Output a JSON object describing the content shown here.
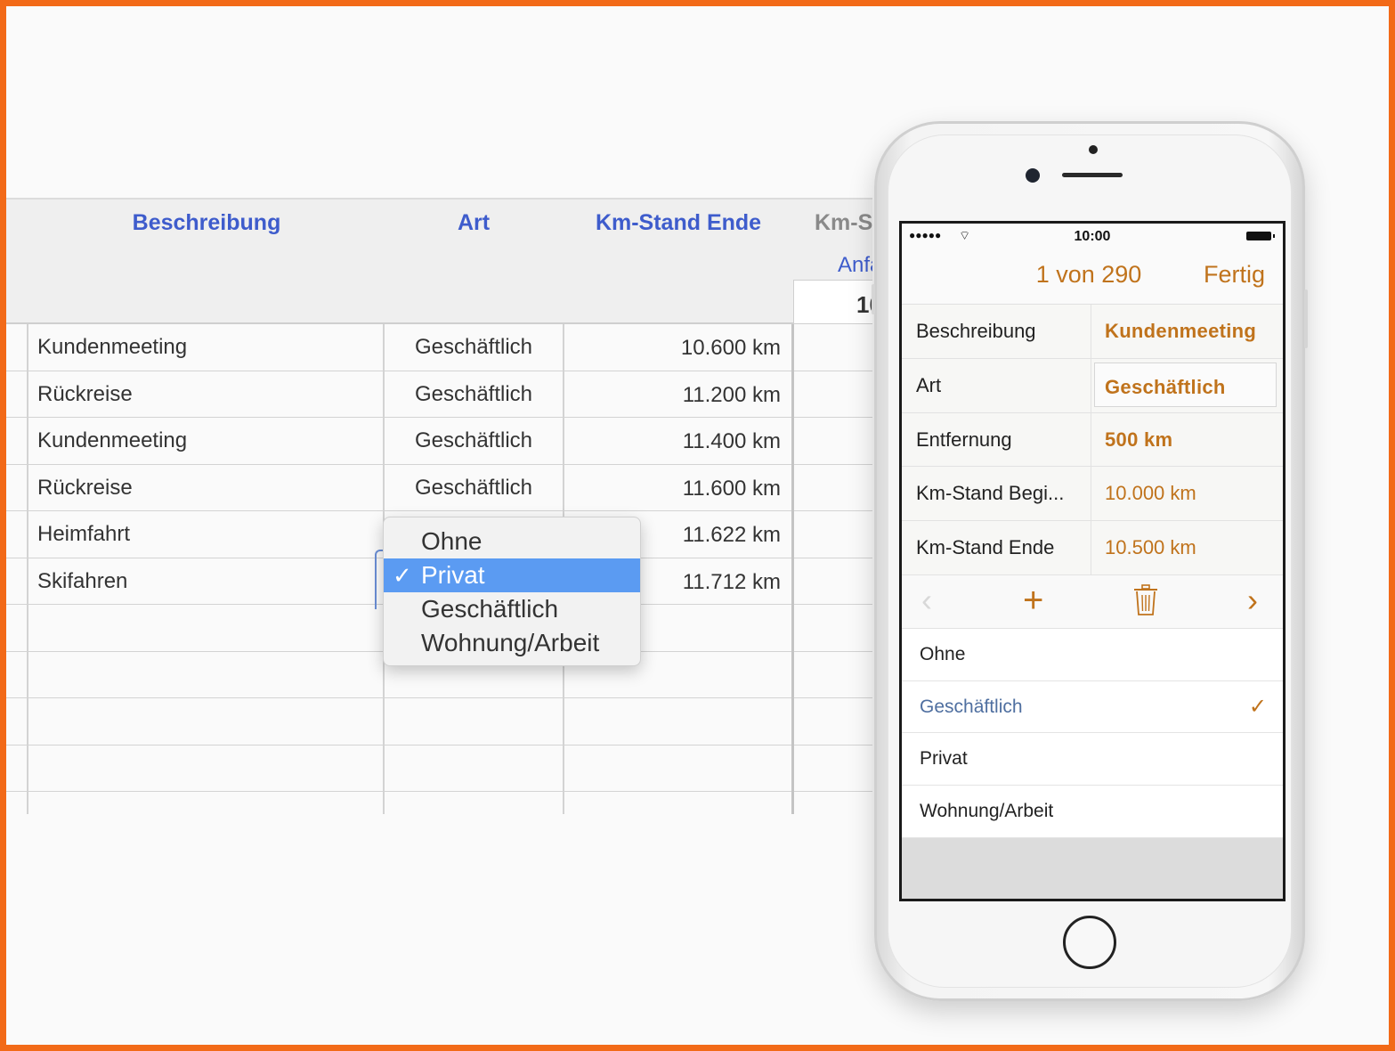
{
  "sheet": {
    "headers": {
      "beschreibung": "Beschreibung",
      "art": "Art",
      "km_ende": "Km-Stand Ende",
      "km_cut": "Km-S",
      "km_cut_sub": "Anfa",
      "box_value": "10"
    },
    "rows": [
      {
        "desc": "Kundenmeeting",
        "art": "Geschäftlich",
        "km": "10.600 km"
      },
      {
        "desc": "Rückreise",
        "art": "Geschäftlich",
        "km": "11.200 km"
      },
      {
        "desc": "Kundenmeeting",
        "art": "Geschäftlich",
        "km": "11.400 km"
      },
      {
        "desc": "Rückreise",
        "art": "Geschäftlich",
        "km": "11.600 km"
      },
      {
        "desc": "Heimfahrt",
        "art": "",
        "km": "11.622 km"
      },
      {
        "desc": "Skifahren",
        "art": "",
        "km": "11.712 km"
      },
      {
        "desc": "",
        "art": "",
        "km": ""
      },
      {
        "desc": "",
        "art": "",
        "km": ""
      },
      {
        "desc": "",
        "art": "",
        "km": ""
      },
      {
        "desc": "",
        "art": "",
        "km": ""
      },
      {
        "desc": "",
        "art": "",
        "km": ""
      }
    ]
  },
  "popup": {
    "items": [
      {
        "label": "Ohne",
        "selected": false
      },
      {
        "label": "Privat",
        "selected": true
      },
      {
        "label": "Geschäftlich",
        "selected": false
      },
      {
        "label": "Wohnung/Arbeit",
        "selected": false
      }
    ],
    "check": "✓"
  },
  "phone": {
    "status": {
      "signal": "●●●●●",
      "wifi": "⌔",
      "time": "10:00"
    },
    "nav": {
      "title": "1 von 290",
      "done": "Fertig"
    },
    "fields": [
      {
        "label": "Beschreibung",
        "value": "Kundenmeeting",
        "style": "bold"
      },
      {
        "label": "Art",
        "value": "Geschäftlich",
        "style": "boxed"
      },
      {
        "label": "Entfernung",
        "value": "500 km",
        "style": "bold"
      },
      {
        "label": "Km-Stand Begi...",
        "value": "10.000 km",
        "style": "normal"
      },
      {
        "label": "Km-Stand Ende",
        "value": "10.500 km",
        "style": "normal"
      }
    ],
    "toolbar": {
      "prev": "‹",
      "add": "+",
      "trash": "🗑",
      "next": "›"
    },
    "options": [
      {
        "label": "Ohne",
        "selected": false
      },
      {
        "label": "Geschäftlich",
        "selected": true
      },
      {
        "label": "Privat",
        "selected": false
      },
      {
        "label": "Wohnung/Arbeit",
        "selected": false
      }
    ],
    "check": "✓"
  },
  "colors": {
    "accent": "#c0731c",
    "sheet_header": "#3e5ccc",
    "menu_highlight": "#5b9bf2",
    "frame": "#f26a18"
  }
}
